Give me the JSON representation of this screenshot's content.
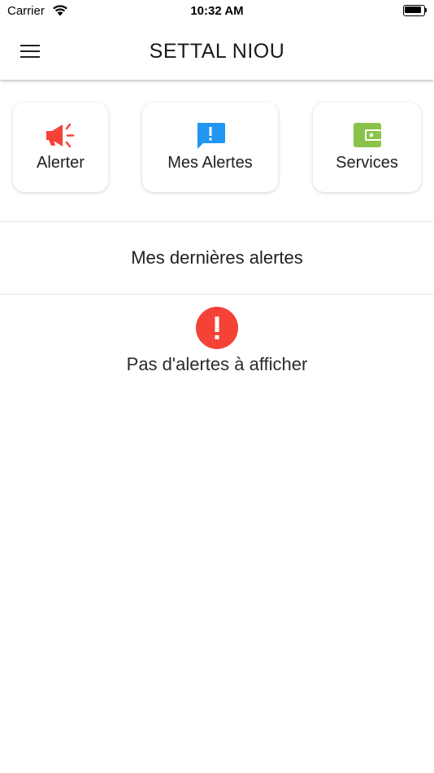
{
  "status_bar": {
    "carrier": "Carrier",
    "time": "10:32 AM",
    "wifi_icon": "wifi-icon",
    "battery_icon": "battery-icon"
  },
  "app_bar": {
    "title": "SETTAL NIOU",
    "menu_icon": "hamburger-menu-icon"
  },
  "actions": [
    {
      "label": "Alerter",
      "icon": "megaphone-icon",
      "color": "#F44336"
    },
    {
      "label": "Mes Alertes",
      "icon": "alert-message-icon",
      "color": "#2196F3"
    },
    {
      "label": "Services",
      "icon": "wallet-icon",
      "color": "#8BC34A"
    }
  ],
  "recent_alerts": {
    "title": "Mes dernières alertes",
    "empty_icon": "error-icon",
    "empty_icon_color": "#F44336",
    "empty_message": "Pas d'alertes à afficher"
  }
}
